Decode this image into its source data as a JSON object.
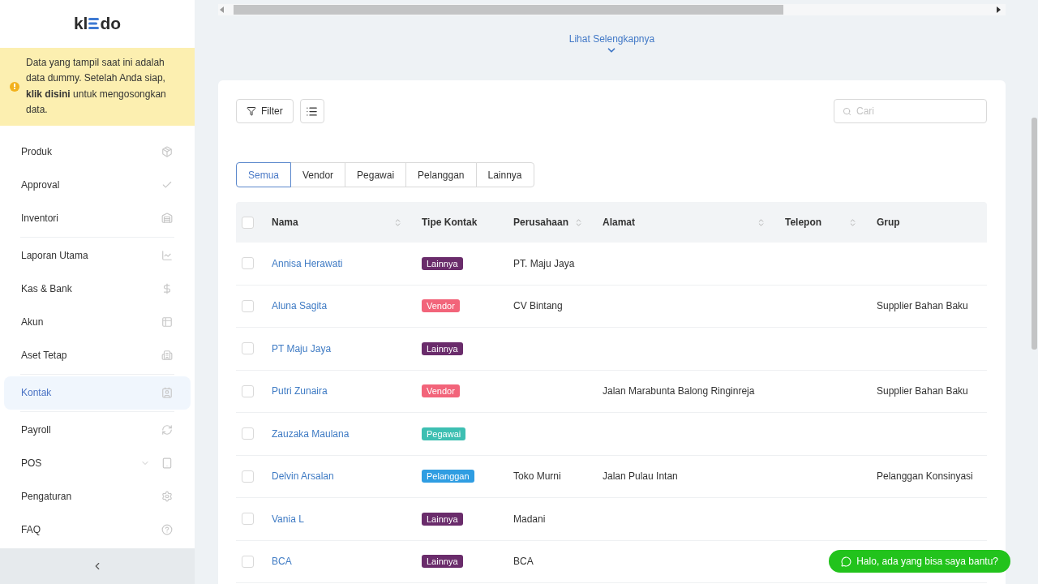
{
  "logo": {
    "left": "kl",
    "right": "do"
  },
  "notice": {
    "text_before": "Data yang tampil saat ini adalah data dummy. Setelah Anda siap,",
    "link": "klik disini",
    "text_after": "untuk mengosongkan data."
  },
  "sidebar": {
    "groups": [
      {
        "items": [
          {
            "label": "Produk",
            "selected": false
          },
          {
            "label": "Approval",
            "selected": false
          },
          {
            "label": "Inventori",
            "selected": false
          }
        ]
      },
      {
        "items": [
          {
            "label": "Laporan Utama",
            "selected": false
          },
          {
            "label": "Kas & Bank",
            "selected": false
          },
          {
            "label": "Akun",
            "selected": false
          },
          {
            "label": "Aset Tetap",
            "selected": false
          }
        ]
      },
      {
        "items": [
          {
            "label": "Kontak",
            "selected": true
          }
        ]
      },
      {
        "items": [
          {
            "label": "Payroll",
            "selected": false
          },
          {
            "label": "POS",
            "selected": false,
            "expandable": true
          },
          {
            "label": "Pengaturan",
            "selected": false
          },
          {
            "label": "FAQ",
            "selected": false
          }
        ]
      }
    ]
  },
  "see_more": "Lihat Selengkapnya",
  "toolbar": {
    "filter": "Filter",
    "search_placeholder": "Cari"
  },
  "tabs": [
    {
      "label": "Semua",
      "selected": true
    },
    {
      "label": "Vendor",
      "selected": false
    },
    {
      "label": "Pegawai",
      "selected": false
    },
    {
      "label": "Pelanggan",
      "selected": false
    },
    {
      "label": "Lainnya",
      "selected": false
    }
  ],
  "table": {
    "header_checked": false,
    "columns": [
      {
        "label": "Nama",
        "sortable": true
      },
      {
        "label": "Tipe Kontak",
        "sortable": false
      },
      {
        "label": "Perusahaan",
        "sortable": true
      },
      {
        "label": "Alamat",
        "sortable": true
      },
      {
        "label": "Telepon",
        "sortable": true
      },
      {
        "label": "Grup",
        "sortable": false
      }
    ],
    "rows": [
      {
        "checked": false,
        "name": "Annisa Herawati",
        "type": {
          "label": "Lainnya",
          "color": "#6a2c6b"
        },
        "company": "PT. Maju Jaya",
        "address": "",
        "phone": "",
        "group": ""
      },
      {
        "checked": false,
        "name": "Aluna Sagita",
        "type": {
          "label": "Vendor",
          "color": "#f2647a"
        },
        "company": "CV Bintang",
        "address": "",
        "phone": "",
        "group": "Supplier Bahan Baku"
      },
      {
        "checked": false,
        "name": "PT Maju Jaya",
        "type": {
          "label": "Lainnya",
          "color": "#6a2c6b"
        },
        "company": "",
        "address": "",
        "phone": "",
        "group": ""
      },
      {
        "checked": false,
        "name": "Putri Zunaira",
        "type": {
          "label": "Vendor",
          "color": "#f2647a"
        },
        "company": "",
        "address": "Jalan Marabunta Balong Ringinreja",
        "phone": "",
        "group": "Supplier Bahan Baku"
      },
      {
        "checked": false,
        "name": "Zauzaka Maulana",
        "type": {
          "label": "Pegawai",
          "color": "#3dbfb2"
        },
        "company": "",
        "address": "",
        "phone": "",
        "group": ""
      },
      {
        "checked": false,
        "name": "Delvin Arsalan",
        "type": {
          "label": "Pelanggan",
          "color": "#2f9de2"
        },
        "company": "Toko Murni",
        "address": "Jalan Pulau Intan",
        "phone": "",
        "group": "Pelanggan Konsinyasi"
      },
      {
        "checked": false,
        "name": "Vania L",
        "type": {
          "label": "Lainnya",
          "color": "#6a2c6b"
        },
        "company": "Madani",
        "address": "",
        "phone": "",
        "group": ""
      },
      {
        "checked": false,
        "name": "BCA",
        "type": {
          "label": "Lainnya",
          "color": "#6a2c6b"
        },
        "company": "BCA",
        "address": "",
        "phone": "",
        "group": ""
      }
    ]
  },
  "chat_button": "Halo, ada yang bisa saya bantu?"
}
